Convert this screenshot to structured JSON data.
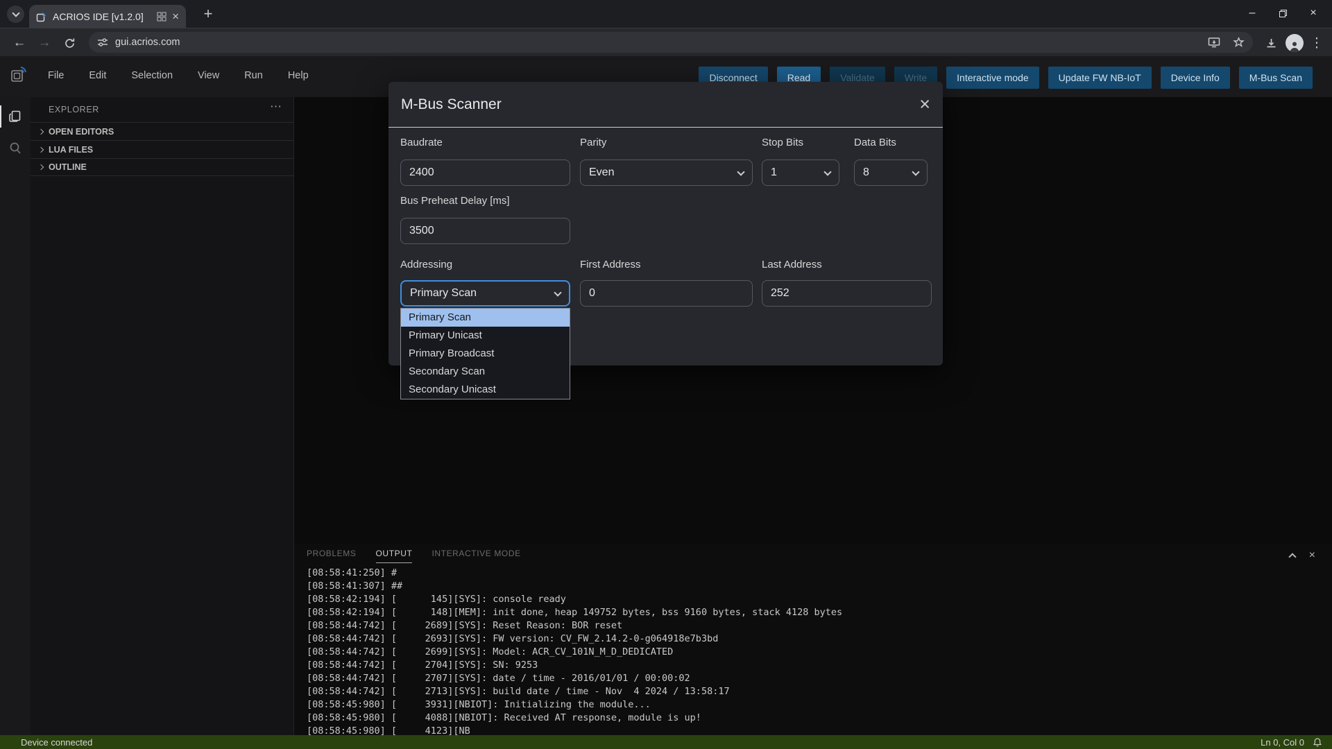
{
  "browser": {
    "tab_title": "ACRIOS IDE [v1.2.0]",
    "url": "gui.acrios.com",
    "new_tab_glyph": "+",
    "close_glyph": "×",
    "minimize_glyph": "–",
    "back_glyph": "←",
    "forward_glyph": "→",
    "kebab_glyph": "⋮"
  },
  "menubar": {
    "items": [
      "File",
      "Edit",
      "Selection",
      "View",
      "Run",
      "Help"
    ]
  },
  "toolbar": {
    "buttons": [
      {
        "label": "Disconnect",
        "state": "normal"
      },
      {
        "label": "Read",
        "state": "primary"
      },
      {
        "label": "Validate",
        "state": "disabled"
      },
      {
        "label": "Write",
        "state": "disabled"
      },
      {
        "label": "Interactive mode",
        "state": "normal"
      },
      {
        "label": "Update FW NB-IoT",
        "state": "normal"
      },
      {
        "label": "Device Info",
        "state": "normal"
      },
      {
        "label": "M-Bus Scan",
        "state": "normal"
      }
    ]
  },
  "sidebar": {
    "title": "EXPLORER",
    "actions_glyph": "⋯",
    "sections": [
      "OPEN EDITORS",
      "LUA FILES",
      "OUTLINE"
    ]
  },
  "modal": {
    "title": "M-Bus Scanner",
    "close_glyph": "×",
    "baudrate_label": "Baudrate",
    "baudrate_value": "2400",
    "parity_label": "Parity",
    "parity_value": "Even",
    "stop_bits_label": "Stop Bits",
    "stop_bits_value": "1",
    "data_bits_label": "Data Bits",
    "data_bits_value": "8",
    "preheat_label": "Bus Preheat Delay [ms]",
    "preheat_value": "3500",
    "addressing_label": "Addressing",
    "addressing_value": "Primary Scan",
    "first_address_label": "First Address",
    "first_address_value": "0",
    "last_address_label": "Last Address",
    "last_address_value": "252",
    "dropdown": {
      "options": [
        "Primary Scan",
        "Primary Unicast",
        "Primary Broadcast",
        "Secondary Scan",
        "Secondary Unicast"
      ],
      "selected": "Primary Scan"
    }
  },
  "panel": {
    "tabs": [
      "PROBLEMS",
      "OUTPUT",
      "INTERACTIVE MODE"
    ],
    "active_tab": "OUTPUT",
    "log_lines": [
      "[08:58:41:250] #",
      "[08:58:41:307] ##",
      "[08:58:42:194] [      145][SYS]: console ready",
      "[08:58:42:194] [      148][MEM]: init done, heap 149752 bytes, bss 9160 bytes, stack 4128 bytes",
      "[08:58:44:742] [     2689][SYS]: Reset Reason: BOR reset",
      "[08:58:44:742] [     2693][SYS]: FW version: CV_FW_2.14.2-0-g064918e7b3bd",
      "[08:58:44:742] [     2699][SYS]: Model: ACR_CV_101N_M_D_DEDICATED",
      "[08:58:44:742] [     2704][SYS]: SN: 9253",
      "[08:58:44:742] [     2707][SYS]: date / time - 2016/01/01 / 00:00:02",
      "[08:58:44:742] [     2713][SYS]: build date / time - Nov  4 2024 / 13:58:17",
      "[08:58:45:980] [     3931][NBIOT]: Initializing the module...",
      "[08:58:45:980] [     4088][NBIOT]: Received AT response, module is up!",
      "[08:58:45:980] [     4123][NB"
    ]
  },
  "statusbar": {
    "left": "Device connected",
    "line_col": "Ln 0, Col 0"
  },
  "colors": {
    "accent_blue": "#3f8fe0",
    "button_blue": "#15486d",
    "status_green": "#2a420e",
    "highlight_blue": "#9fc0ee"
  }
}
